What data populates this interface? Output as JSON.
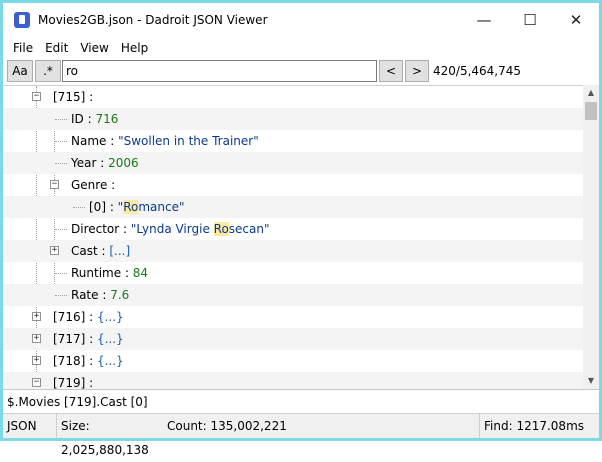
{
  "window": {
    "title": "Movies2GB.json - Dadroit JSON Viewer",
    "min_glyph": "—",
    "max_glyph": "☐",
    "close_glyph": "✕"
  },
  "menu": [
    "File",
    "Edit",
    "View",
    "Help"
  ],
  "toolbar": {
    "case_label": "Aa",
    "regex_label": ".*",
    "search_value": "ro",
    "prev_label": "<",
    "next_label": ">",
    "match_count": "420/5,464,745"
  },
  "tree": {
    "node_715": {
      "key": "[715]",
      "sep": " :",
      "expanded": true
    },
    "id": {
      "key": "ID",
      "sep": " : ",
      "value": "716"
    },
    "name": {
      "key": "Name",
      "sep": " : ",
      "value": "\"Swollen in the Trainer\""
    },
    "year": {
      "key": "Year",
      "sep": " : ",
      "value": "2006"
    },
    "genre": {
      "key": "Genre",
      "sep": " :",
      "expanded": true
    },
    "genre_0": {
      "key": "[0]",
      "sep": " : ",
      "pre": "\"",
      "hl": "Ro",
      "post": "mance\""
    },
    "director": {
      "key": "Director",
      "sep": " : ",
      "pre": "\"Lynda Virgie ",
      "hl": "Ro",
      "post": "secan\""
    },
    "cast": {
      "key": "Cast",
      "sep": " : ",
      "value": "[...]",
      "expanded": false
    },
    "runtime": {
      "key": "Runtime",
      "sep": " : ",
      "value": "84"
    },
    "rate": {
      "key": "Rate",
      "sep": " : ",
      "value": "7.6"
    },
    "node_716": {
      "key": "[716]",
      "sep": " : ",
      "value": "{...}",
      "expanded": false
    },
    "node_717": {
      "key": "[717]",
      "sep": " : ",
      "value": "{...}",
      "expanded": false
    },
    "node_718": {
      "key": "[718]",
      "sep": " : ",
      "value": "{...}",
      "expanded": false
    },
    "node_719": {
      "key": "[719]",
      "sep": " :",
      "expanded": true
    }
  },
  "path": "$.Movies [719].Cast [0]",
  "status": {
    "format": "JSON",
    "size": "Size: 2,025,880,138",
    "count": "Count: 135,002,221",
    "find": "Find: 1217.08ms"
  },
  "colors": {
    "number": "#1a7a1a",
    "string": "#0b3a8c",
    "highlight": "#fdeaa0",
    "window_border": "#7fd8e6"
  }
}
